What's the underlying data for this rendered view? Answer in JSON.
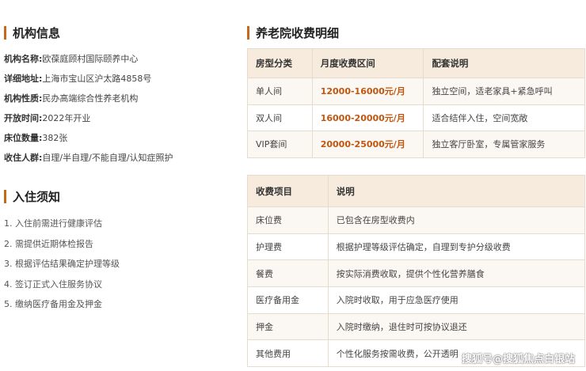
{
  "org": {
    "title": "机构信息",
    "fields": [
      {
        "key": "机构名称:",
        "value": "欧葆庭顾村国际颐养中心"
      },
      {
        "key": "详细地址:",
        "value": "上海市宝山区沪太路4858号"
      },
      {
        "key": "机构性质:",
        "value": "民办高端综合性养老机构"
      },
      {
        "key": "开放时间:",
        "value": "2022年开业"
      },
      {
        "key": "床位数量:",
        "value": "382张"
      },
      {
        "key": "收住人群:",
        "value": "自理/半自理/不能自理/认知症照护"
      }
    ]
  },
  "admission": {
    "title": "入住须知",
    "steps": [
      "1. 入住前需进行健康评估",
      "2. 需提供近期体检报告",
      "3. 根据评估结果确定护理等级",
      "4. 签订正式入住服务协议",
      "5. 缴纳医疗备用金及押金"
    ]
  },
  "fees": {
    "title": "养老院收费明细",
    "headers": [
      "房型分类",
      "月度收费区间",
      "配套说明"
    ],
    "rows": [
      [
        "单人间",
        "12000-16000元/月",
        "独立空间，适老家具+紧急呼叫"
      ],
      [
        "双人间",
        "16000-20000元/月",
        "适合结伴入住，空间宽敞"
      ],
      [
        "VIP套间",
        "20000-25000元/月",
        "独立客厅卧室，专属管家服务"
      ]
    ]
  },
  "items": {
    "headers": [
      "收费项目",
      "说明"
    ],
    "rows": [
      [
        "床位费",
        "已包含在房型收费内"
      ],
      [
        "护理费",
        "根据护理等级评估确定，自理到专护分级收费"
      ],
      [
        "餐费",
        "按实际消费收取，提供个性化营养膳食"
      ],
      [
        "医疗备用金",
        "入院时收取，用于应急医疗使用"
      ],
      [
        "押金",
        "入院时缴纳，退住时可按协议退还"
      ],
      [
        "其他费用",
        "个性化服务按需收费，公开透明"
      ]
    ]
  },
  "watermark": "搜狐号@搜狐焦点白银站",
  "colors": {
    "accent": "#c46a1a",
    "price": "#c0560f",
    "header_bg": "#f6ebdc",
    "row_bg": "#fbf8f3"
  }
}
